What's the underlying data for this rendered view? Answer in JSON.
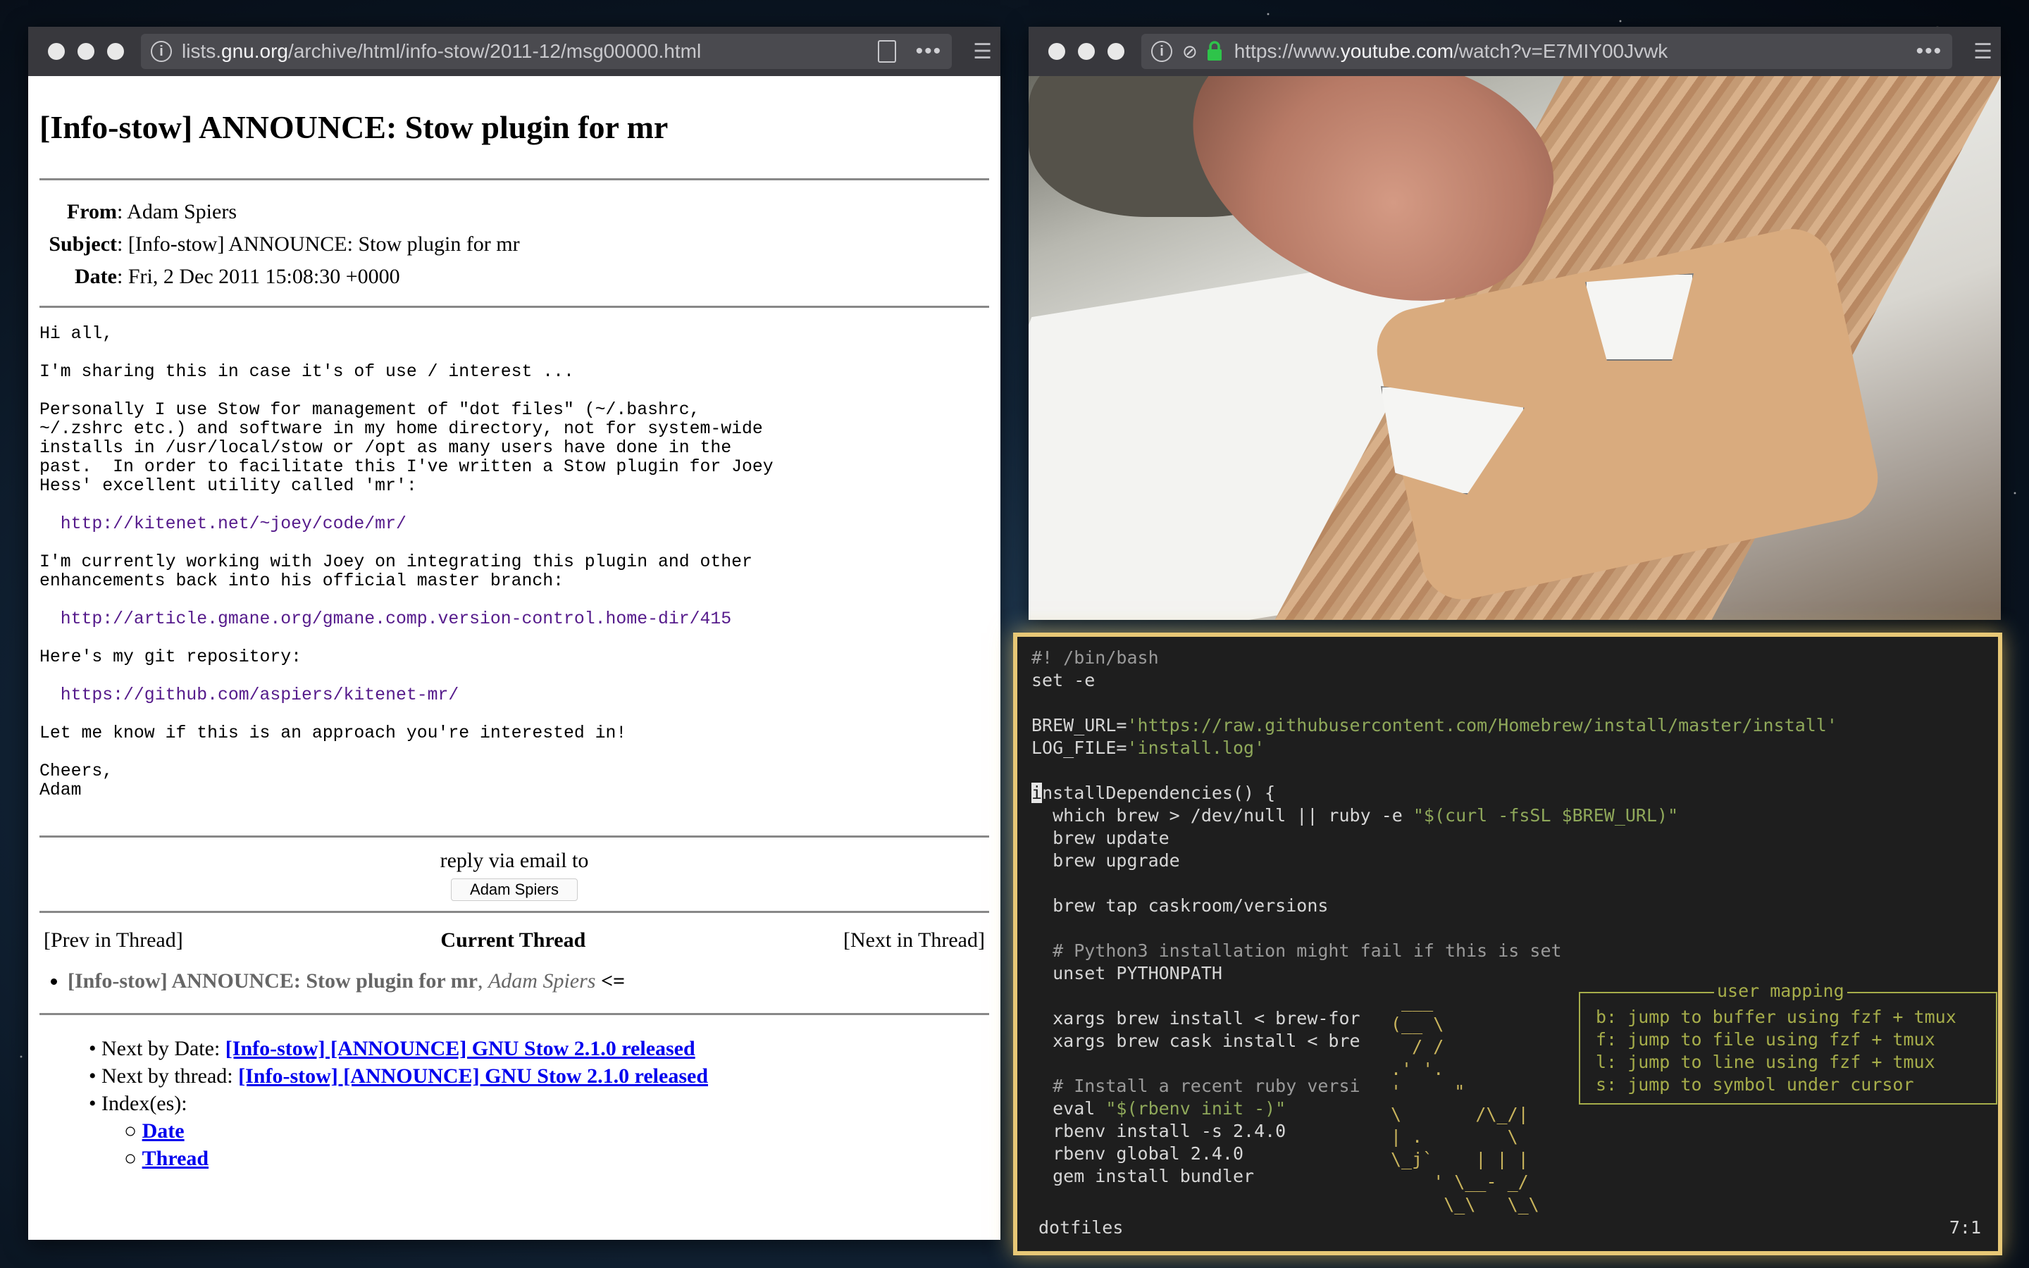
{
  "left_browser": {
    "url": {
      "prefix": "lists.",
      "host": "gnu.org",
      "path": "/archive/html/info-stow/2011-12/msg00000.html"
    },
    "page": {
      "title": "[Info-stow] ANNOUNCE: Stow plugin for mr",
      "headers": {
        "from_label": "From",
        "from_value": ": Adam Spiers",
        "subject_label": "Subject",
        "subject_value": ": [Info-stow] ANNOUNCE: Stow plugin for mr",
        "date_label": "Date",
        "date_value": ": Fri, 2 Dec 2011 15:08:30 +0000"
      },
      "body": {
        "p1": "Hi all,",
        "p2": "I'm sharing this in case it's of use / interest ...",
        "p3": "Personally I use Stow for management of \"dot files\" (~/.bashrc,\n~/.zshrc etc.) and software in my home directory, not for system-wide\ninstalls in /usr/local/stow or /opt as many users have done in the\npast.  In order to facilitate this I've written a Stow plugin for Joey\nHess' excellent utility called 'mr':",
        "link1": "http://kitenet.net/~joey/code/mr/",
        "p4": "I'm currently working with Joey on integrating this plugin and other\nenhancements back into his official master branch:",
        "link2": "http://article.gmane.org/gmane.comp.version-control.home-dir/415",
        "p5": "Here's my git repository:",
        "link3": "https://github.com/aspiers/kitenet-mr/",
        "p6": "Let me know if this is an approach you're interested in!",
        "p7": "Cheers,\nAdam"
      },
      "reply": {
        "text": "reply via email to",
        "button": "Adam Spiers"
      },
      "thread_nav": {
        "prev": "[Prev in Thread]",
        "current": "Current Thread",
        "next": "[Next in Thread]"
      },
      "thread_item": {
        "title": "[Info-stow] ANNOUNCE: Stow plugin for mr",
        "sep": ", ",
        "author": "Adam Spiers",
        "marker": " <="
      },
      "nav_links": {
        "next_by_date_label": "Next by Date: ",
        "next_by_date_link": "[Info-stow] [ANNOUNCE] GNU Stow 2.1.0 released",
        "next_by_thread_label": "Next by thread: ",
        "next_by_thread_link": "[Info-stow] [ANNOUNCE] GNU Stow 2.1.0 released",
        "index_label": "Index(es):",
        "index_date": "Date",
        "index_thread": "Thread"
      }
    }
  },
  "right_browser": {
    "url": {
      "prefix": "https://www.",
      "host": "youtube.com",
      "path": "/watch?v=E7MIY00Jvwk"
    }
  },
  "terminal": {
    "line1": "#! /bin/bash",
    "line2": "set -e",
    "brew_url_key": "BREW_URL=",
    "brew_url_val": "'https://raw.githubusercontent.com/Homebrew/install/master/install'",
    "log_file_key": "LOG_FILE=",
    "log_file_val": "'install.log'",
    "cursor_char": "i",
    "func_rest": "nstallDependencies() {",
    "which_pre": "  which brew > /dev/null || ruby -e ",
    "which_str": "\"$(curl -fsSL $BREW_URL)\"",
    "brew_update": "  brew update",
    "brew_upgrade": "  brew upgrade",
    "tap": "  brew tap caskroom/versions",
    "comment1": "  # Python3 installation might fail if this is set",
    "unset": "  unset PYTHONPATH",
    "xargs1": "  xargs brew install < brew-for",
    "xargs2": "  xargs brew cask install < bre",
    "comment2": "  # Install a recent ruby versi",
    "eval_pre": "  eval ",
    "eval_str": "\"$(rbenv init -)\"",
    "rbenv_install": "  rbenv install -s 2.4.0",
    "rbenv_global": "  rbenv global 2.4.0",
    "gem": "  gem install bundler",
    "ascii_art": " ___\n(__ \\\n  / /\n.' '.\n'     \"\n\\       /\\_/|\n| .        \\\n\\_j`    | | |\n    ' \\__- _/\n     \\_\\   \\_\\",
    "popup": {
      "title": "user mapping",
      "lines": "b: jump to buffer using fzf + tmux\nf: jump to file using fzf + tmux\nl: jump to line using fzf + tmux\ns: jump to symbol under cursor"
    },
    "status_left": "dotfiles",
    "status_right": "7:1"
  },
  "colors": {
    "terminal_border": "#e8c876",
    "string": "#8fa85a",
    "popup": "#a6ad4a"
  }
}
